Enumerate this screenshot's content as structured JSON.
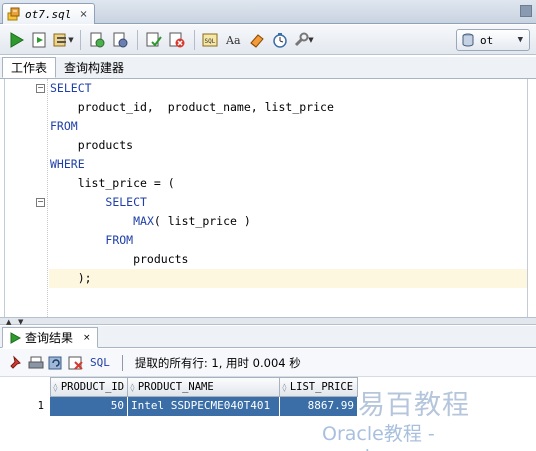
{
  "doc_tab": {
    "title": "ot7.sql",
    "close": "×"
  },
  "toolbar": {
    "buttons": [
      "run-statement",
      "run-script",
      "autotrace",
      "explain-plan",
      "sql-tuning",
      "commit",
      "rollback",
      "sql-history",
      "unabbreviate",
      "clear",
      "sql-monitor",
      "format"
    ]
  },
  "connection": {
    "label": "ot"
  },
  "worksheet_tabs": [
    "工作表",
    "查询构建器"
  ],
  "editor": {
    "lines": [
      {
        "parts": [
          {
            "t": "SELECT",
            "kw": true
          }
        ]
      },
      {
        "parts": [
          {
            "t": "    product_id,  product_name, list_price",
            "kw": false
          }
        ]
      },
      {
        "parts": [
          {
            "t": "FROM",
            "kw": true
          }
        ]
      },
      {
        "parts": [
          {
            "t": "    products",
            "kw": false
          }
        ]
      },
      {
        "parts": [
          {
            "t": "WHERE",
            "kw": true
          }
        ]
      },
      {
        "parts": [
          {
            "t": "    list_price = (",
            "kw": false
          }
        ]
      },
      {
        "parts": [
          {
            "t": "        ",
            "kw": false
          },
          {
            "t": "SELECT",
            "kw": true
          }
        ]
      },
      {
        "parts": [
          {
            "t": "            ",
            "kw": false
          },
          {
            "t": "MAX",
            "kw": true
          },
          {
            "t": "( list_price )",
            "kw": false
          }
        ]
      },
      {
        "parts": [
          {
            "t": "        ",
            "kw": false
          },
          {
            "t": "FROM",
            "kw": true
          }
        ]
      },
      {
        "parts": [
          {
            "t": "            products",
            "kw": false
          }
        ]
      },
      {
        "parts": [
          {
            "t": "    );",
            "kw": false
          }
        ],
        "highlight": true
      }
    ]
  },
  "results": {
    "tab_label": "查询结果",
    "tab_close": "×",
    "sql_label": "SQL",
    "status": "提取的所有行: 1, 用时 0.004 秒",
    "columns": [
      "PRODUCT_ID",
      "PRODUCT_NAME",
      "LIST_PRICE"
    ],
    "rows": [
      {
        "n": "1",
        "cells": [
          "50",
          "Intel SSDPECME040T401",
          "8867.99"
        ]
      }
    ]
  },
  "watermark": {
    "line1": "易百教程",
    "line2": "Oracle教程 - oraok.com"
  },
  "colors": {
    "keyword": "#1f3fa8",
    "selection": "#3b6ea6",
    "current_line": "#fdf7e0"
  }
}
